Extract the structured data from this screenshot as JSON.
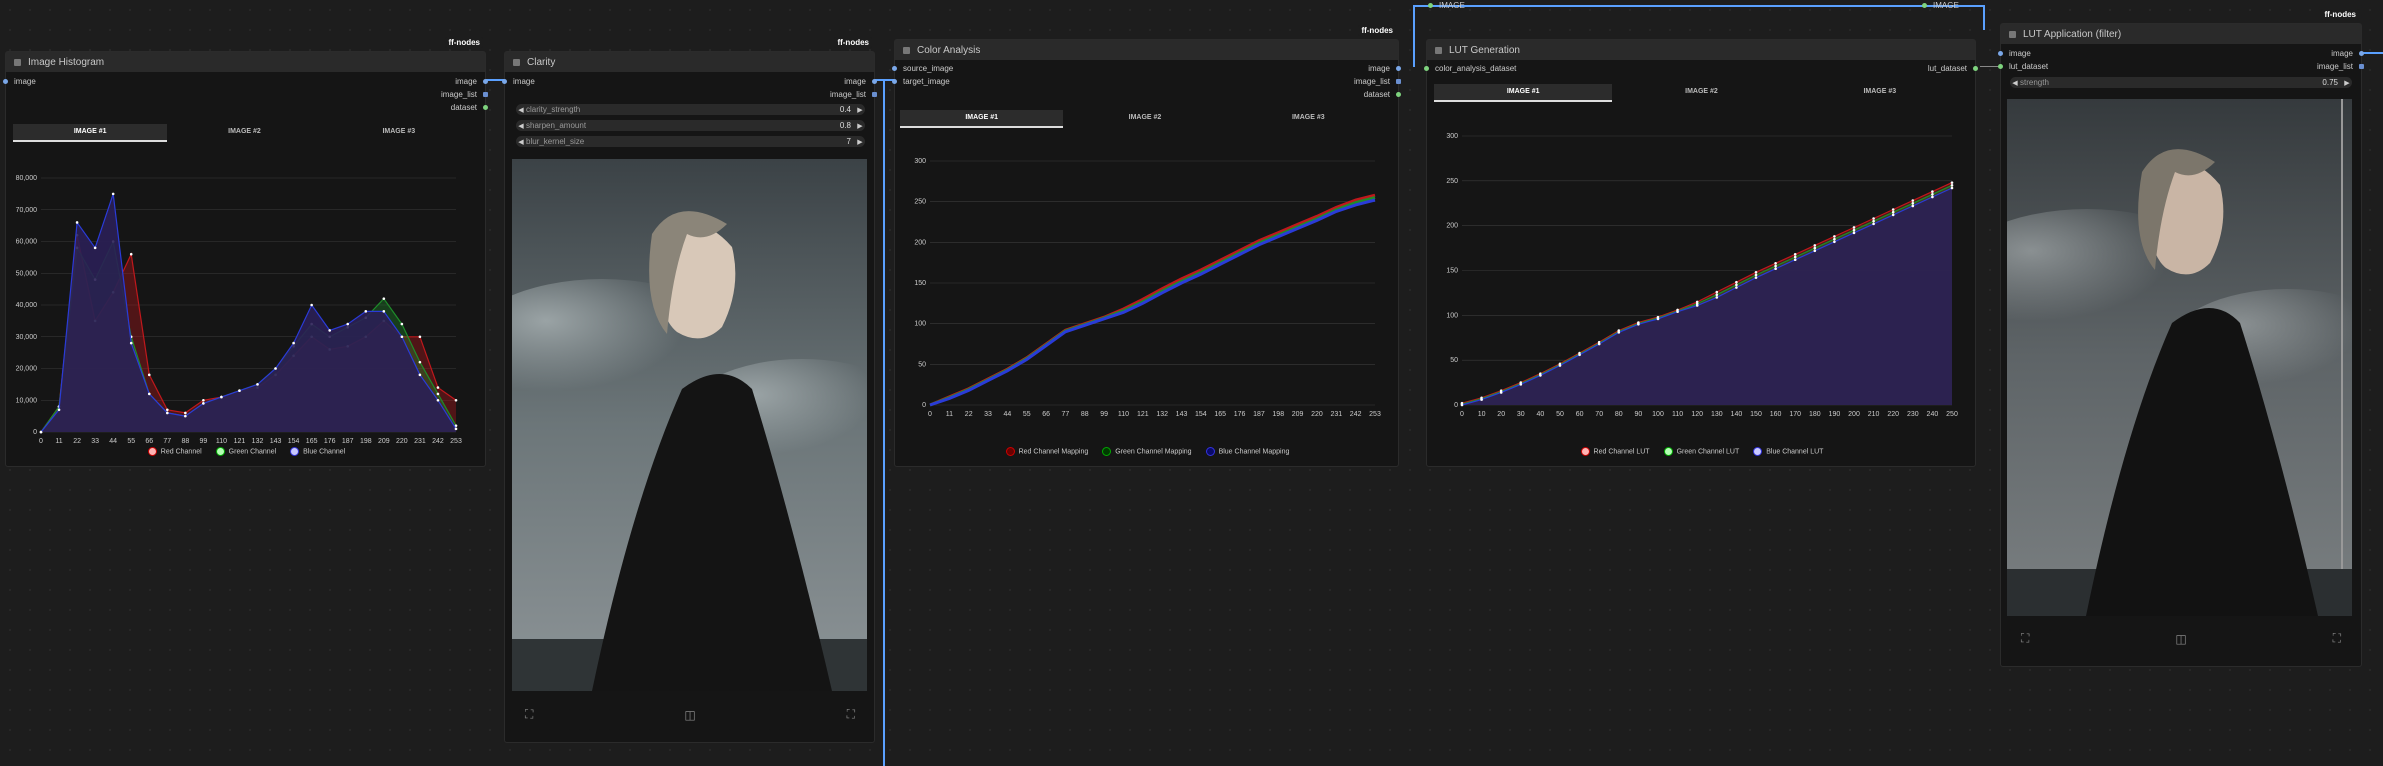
{
  "badge": "ff-nodes",
  "top_links": {
    "image_a": "IMAGE",
    "image_b": "IMAGE"
  },
  "histogram": {
    "title": "Image Histogram",
    "in_ports": [
      "image"
    ],
    "out_ports": [
      "image",
      "image_list",
      "dataset"
    ],
    "tabs": [
      "IMAGE #1",
      "IMAGE #2",
      "IMAGE #3"
    ],
    "legend": [
      "Red Channel",
      "Green Channel",
      "Blue Channel"
    ]
  },
  "clarity": {
    "title": "Clarity",
    "in_ports": [
      "image"
    ],
    "out_ports": [
      "image",
      "image_list"
    ],
    "widgets": [
      {
        "label": "clarity_strength",
        "value": "0.4"
      },
      {
        "label": "sharpen_amount",
        "value": "0.8"
      },
      {
        "label": "blur_kernel_size",
        "value": "7"
      }
    ]
  },
  "color_analysis": {
    "title": "Color Analysis",
    "in_ports": [
      "source_image",
      "target_image"
    ],
    "out_ports": [
      "image",
      "image_list",
      "dataset"
    ],
    "tabs": [
      "IMAGE #1",
      "IMAGE #2",
      "IMAGE #3"
    ],
    "legend": [
      "Red Channel Mapping",
      "Green Channel Mapping",
      "Blue Channel Mapping"
    ]
  },
  "lut_generation": {
    "title": "LUT Generation",
    "in_ports": [
      "color_analysis_dataset"
    ],
    "out_ports": [
      "lut_dataset"
    ],
    "tabs": [
      "IMAGE #1",
      "IMAGE #2",
      "IMAGE #3"
    ],
    "legend": [
      "Red Channel LUT",
      "Green Channel LUT",
      "Blue Channel LUT"
    ]
  },
  "lut_application": {
    "title": "LUT Application (filter)",
    "in_ports": [
      "image",
      "lut_dataset"
    ],
    "out_ports": [
      "image",
      "image_list"
    ],
    "widget": {
      "label": "strength",
      "value": "0.75"
    }
  },
  "colors": {
    "red": "#c0181c",
    "green": "#1e8c2a",
    "blue": "#2a3bd8",
    "purple": "#2a1f55",
    "link": "#5aa0ff"
  },
  "chart_data": [
    {
      "type": "area",
      "x": [
        0,
        11,
        22,
        33,
        44,
        55,
        66,
        77,
        88,
        99,
        110,
        121,
        132,
        143,
        154,
        165,
        176,
        187,
        198,
        209,
        220,
        231,
        242,
        253
      ],
      "x_tick_labels": [
        "0",
        "11",
        "22",
        "33",
        "44",
        "55",
        "66",
        "77",
        "88",
        "99",
        "110",
        "121",
        "132",
        "143",
        "154",
        "165",
        "176",
        "187",
        "198",
        "209",
        "220",
        "231",
        "242",
        "253"
      ],
      "y_tick_labels": [
        "0",
        "10,000",
        "20,000",
        "30,000",
        "40,000",
        "50,000",
        "60,000",
        "70,000",
        "80,000"
      ],
      "ylim": [
        0,
        80000
      ],
      "series": [
        {
          "name": "Red Channel",
          "values": [
            0,
            8000,
            62000,
            35000,
            44000,
            56000,
            18000,
            7000,
            6000,
            10000,
            11000,
            13000,
            14000,
            18000,
            24000,
            30000,
            26000,
            27000,
            30000,
            35000,
            30000,
            30000,
            14000,
            10000
          ]
        },
        {
          "name": "Green Channel",
          "values": [
            0,
            8000,
            58000,
            48000,
            60000,
            30000,
            12000,
            6000,
            5000,
            9000,
            11000,
            13000,
            15000,
            20000,
            27000,
            34000,
            30000,
            33000,
            36000,
            42000,
            34000,
            22000,
            12000,
            2000
          ]
        },
        {
          "name": "Blue Channel",
          "values": [
            0,
            7000,
            66000,
            58000,
            75000,
            28000,
            12000,
            6000,
            5000,
            9000,
            11000,
            13000,
            15000,
            20000,
            28000,
            40000,
            32000,
            34000,
            38000,
            38000,
            30000,
            18000,
            10000,
            1000
          ]
        }
      ]
    },
    {
      "type": "line",
      "x": [
        0,
        11,
        22,
        33,
        44,
        55,
        66,
        77,
        88,
        99,
        110,
        121,
        132,
        143,
        154,
        165,
        176,
        187,
        198,
        209,
        220,
        231,
        242,
        253
      ],
      "x_tick_labels": [
        "0",
        "11",
        "22",
        "33",
        "44",
        "55",
        "66",
        "77",
        "88",
        "99",
        "110",
        "121",
        "132",
        "143",
        "154",
        "165",
        "176",
        "187",
        "198",
        "209",
        "220",
        "231",
        "242",
        "253"
      ],
      "y_tick_labels": [
        "0",
        "50",
        "100",
        "150",
        "200",
        "250",
        "300"
      ],
      "ylim": [
        0,
        300
      ],
      "series": [
        {
          "name": "Red Channel Mapping",
          "values": [
            0,
            10,
            20,
            32,
            44,
            58,
            75,
            92,
            100,
            108,
            118,
            130,
            143,
            155,
            166,
            178,
            190,
            202,
            212,
            222,
            232,
            243,
            252,
            258
          ]
        },
        {
          "name": "Green Channel Mapping",
          "values": [
            0,
            9,
            19,
            31,
            43,
            57,
            74,
            91,
            99,
            107,
            116,
            127,
            140,
            152,
            163,
            175,
            187,
            199,
            209,
            219,
            229,
            240,
            249,
            255
          ]
        },
        {
          "name": "Blue Channel Mapping",
          "values": [
            0,
            8,
            18,
            30,
            42,
            56,
            73,
            90,
            98,
            106,
            114,
            125,
            138,
            150,
            161,
            173,
            185,
            197,
            207,
            217,
            227,
            238,
            246,
            252
          ]
        }
      ]
    },
    {
      "type": "area",
      "x": [
        0,
        10,
        20,
        30,
        40,
        50,
        60,
        70,
        80,
        90,
        100,
        110,
        120,
        130,
        140,
        150,
        160,
        170,
        180,
        190,
        200,
        210,
        220,
        230,
        240,
        250
      ],
      "x_tick_labels": [
        "0",
        "10",
        "20",
        "30",
        "40",
        "50",
        "60",
        "70",
        "80",
        "90",
        "100",
        "110",
        "120",
        "130",
        "140",
        "150",
        "160",
        "170",
        "180",
        "190",
        "200",
        "210",
        "220",
        "230",
        "240",
        "250"
      ],
      "y_tick_labels": [
        "0",
        "50",
        "100",
        "150",
        "200",
        "250",
        "300"
      ],
      "ylim": [
        0,
        300
      ],
      "series": [
        {
          "name": "Red Channel LUT",
          "values": [
            2,
            8,
            16,
            25,
            35,
            46,
            58,
            70,
            83,
            92,
            98,
            106,
            115,
            126,
            137,
            148,
            158,
            168,
            178,
            188,
            198,
            208,
            218,
            228,
            238,
            248
          ]
        },
        {
          "name": "Green Channel LUT",
          "values": [
            1,
            7,
            15,
            24,
            34,
            45,
            57,
            69,
            82,
            91,
            97,
            105,
            113,
            123,
            134,
            145,
            155,
            165,
            175,
            185,
            195,
            205,
            215,
            225,
            235,
            245
          ]
        },
        {
          "name": "Blue Channel LUT",
          "values": [
            0,
            6,
            14,
            23,
            33,
            44,
            56,
            68,
            81,
            90,
            96,
            104,
            111,
            120,
            131,
            142,
            152,
            162,
            172,
            182,
            192,
            202,
            212,
            222,
            232,
            242
          ]
        }
      ]
    }
  ]
}
